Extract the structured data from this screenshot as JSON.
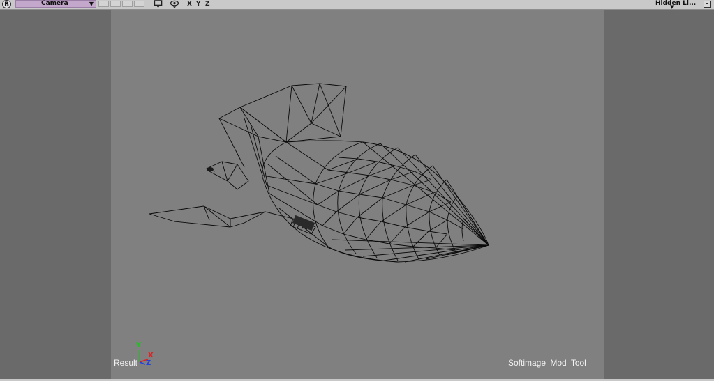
{
  "toolbar": {
    "view_letter": "B",
    "camera_label": "Camera",
    "camera_arrow": "▼",
    "axis_x": "X",
    "axis_y": "Y",
    "axis_z": "Z",
    "display_mode": "Hidden Li..."
  },
  "viewport": {
    "bottom_left_label": "Result",
    "bottom_right_label": "Softimage  Mod  Tool",
    "gizmo": {
      "x": "X",
      "y": "Y",
      "z": "Z"
    }
  },
  "colors": {
    "toolbar_bg": "#c9c9c9",
    "camera_select_bg": "#c4a8cc",
    "viewport_outer": "#6a6a6a",
    "camera_frame": "#808080",
    "wireframe": "#0a0a0a",
    "gizmo_x": "#e02020",
    "gizmo_y": "#20c020",
    "gizmo_z": "#2040e0"
  },
  "icons": [
    "view-letter-icon",
    "camera-dropdown-arrow-icon",
    "monitor-icon",
    "eye-icon",
    "maximize-icon",
    "axis-gizmo-icon"
  ]
}
